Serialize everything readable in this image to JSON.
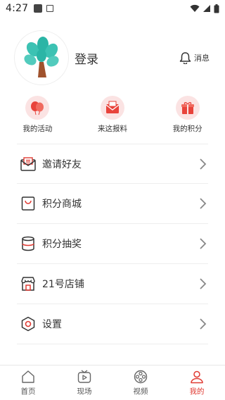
{
  "status_bar": {
    "time": "4:27"
  },
  "profile": {
    "login_label": "登录",
    "message_label": "消息"
  },
  "quick_actions": [
    {
      "label": "我的活动",
      "icon": "balloons-icon"
    },
    {
      "label": "来这报料",
      "icon": "envelope-icon"
    },
    {
      "label": "我的积分",
      "icon": "gift-icon"
    }
  ],
  "menu": [
    {
      "label": "邀请好友",
      "icon": "mail-icon"
    },
    {
      "label": "积分商城",
      "icon": "shopping-bag-icon"
    },
    {
      "label": "积分抽奖",
      "icon": "database-icon"
    },
    {
      "label": "21号店铺",
      "icon": "store-icon"
    },
    {
      "label": "设置",
      "icon": "settings-icon"
    }
  ],
  "tabs": [
    {
      "label": "首页",
      "icon": "home-icon",
      "active": false
    },
    {
      "label": "现场",
      "icon": "tv-icon",
      "active": false
    },
    {
      "label": "视频",
      "icon": "film-reel-icon",
      "active": false
    },
    {
      "label": "我的",
      "icon": "user-icon",
      "active": true
    }
  ],
  "colors": {
    "accent": "#e03b33",
    "soft_pink": "#fbe3e3",
    "tree_green": "#3cc2b3",
    "trunk": "#a0522d"
  }
}
